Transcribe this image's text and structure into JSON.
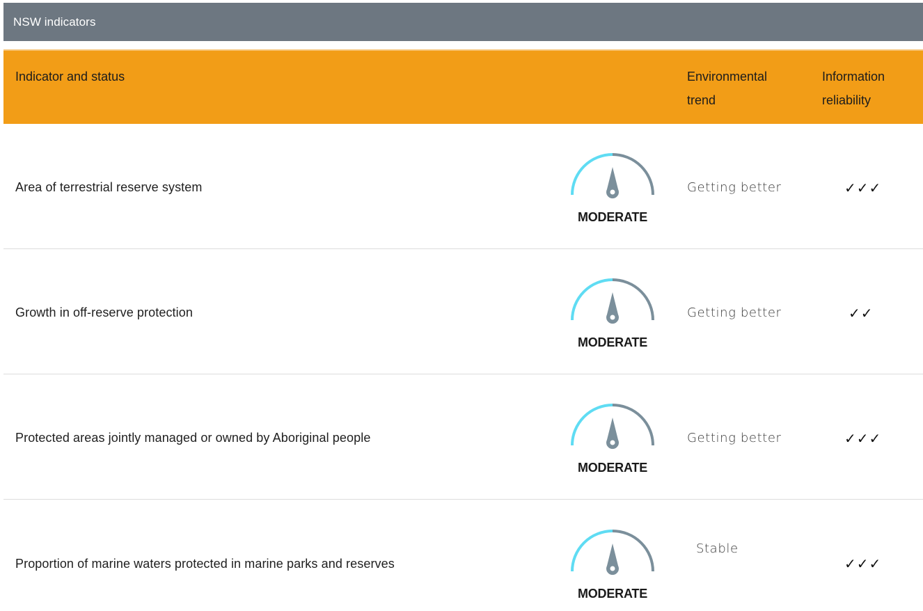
{
  "window": {
    "title": "NSW indicators"
  },
  "table": {
    "headers": {
      "indicator": "Indicator and status",
      "trend_line1": "Environmental",
      "trend_line2": "trend",
      "reliability_line1": "Information",
      "reliability_line2": "reliability"
    },
    "rows": [
      {
        "indicator": "Area of terrestrial reserve system",
        "status": "MODERATE",
        "trend": "Getting better",
        "reliability": "✓✓✓"
      },
      {
        "indicator": "Growth in off-reserve protection",
        "status": "MODERATE",
        "trend": "Getting better",
        "reliability": "✓✓"
      },
      {
        "indicator": "Protected areas jointly managed or owned by Aboriginal people",
        "status": "MODERATE",
        "trend": "Getting better",
        "reliability": "✓✓✓"
      },
      {
        "indicator": "Proportion of marine waters protected in marine parks and reserves",
        "status": "MODERATE",
        "trend": "Stable",
        "reliability": "✓✓✓"
      }
    ]
  },
  "colors": {
    "titlebar": "#6d7781",
    "header": "#f29d17",
    "gauge_left_arc": "#5fdcf3",
    "gauge_right_arc": "#7b8f9b",
    "gauge_needle": "#7b8f9b"
  },
  "icons": {
    "gauge": "moderate-gauge-icon",
    "tick": "check-mark"
  }
}
